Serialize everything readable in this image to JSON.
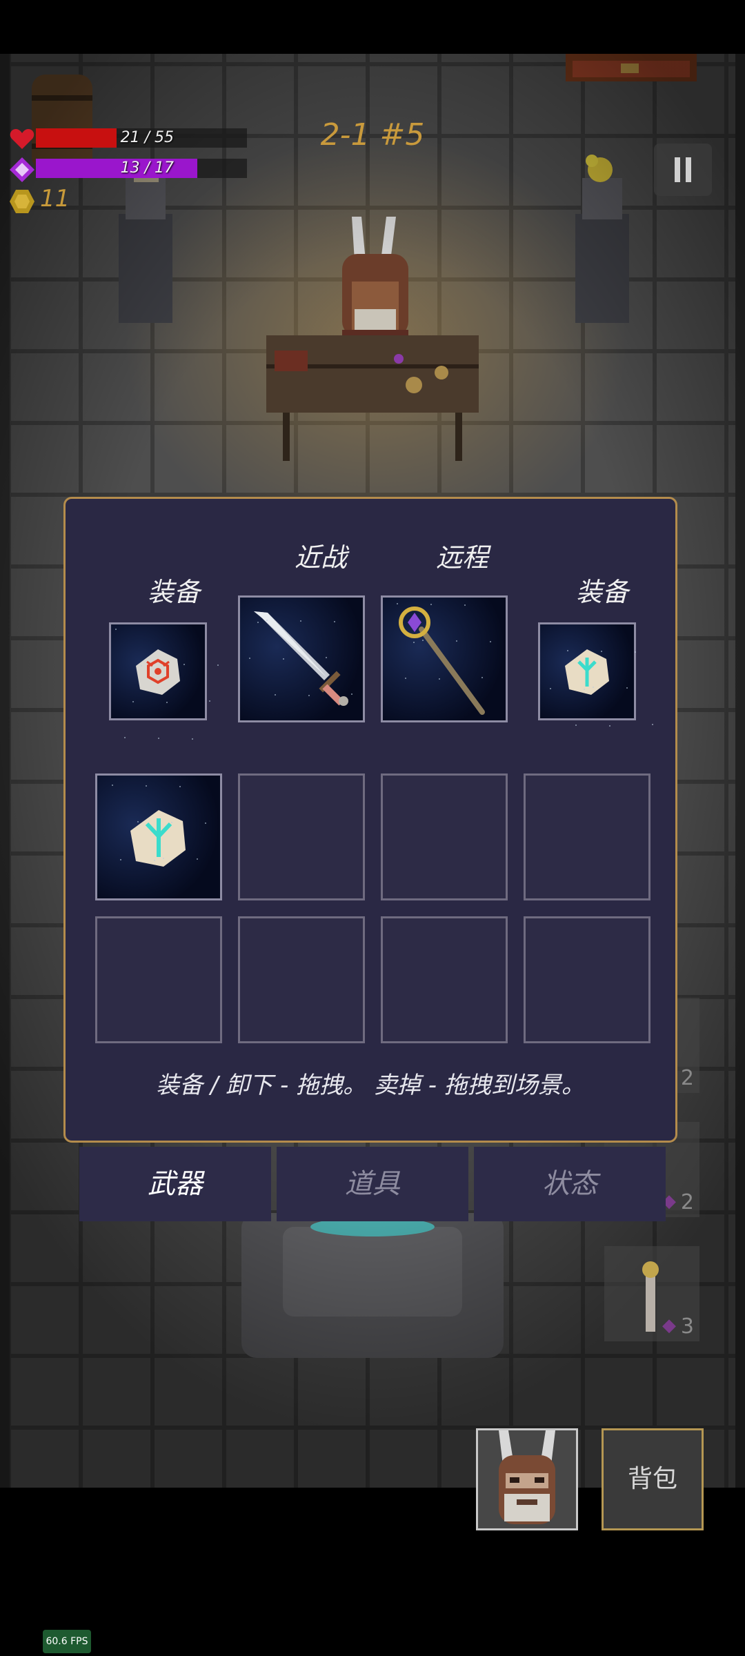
{
  "hud": {
    "health": {
      "current": 21,
      "max": 55,
      "text": "21 / 55",
      "color": "#c81010"
    },
    "mana": {
      "current": 13,
      "max": 17,
      "text": "13 / 17",
      "color": "#9a16cc"
    },
    "coins": "11",
    "level": "2-1 #5"
  },
  "side_slots": [
    "2",
    "2",
    "3"
  ],
  "panel": {
    "labels": {
      "equip_left": "装备",
      "melee": "近战",
      "ranged": "远程",
      "equip_right": "装备"
    },
    "equipped": {
      "equip_left_icon": "red-rune-stone-icon",
      "melee_icon": "sword-icon",
      "ranged_icon": "magic-staff-icon",
      "equip_right_icon": "cyan-rune-stone-icon"
    },
    "inventory": [
      "cyan-rune-stone-icon",
      "",
      "",
      "",
      "",
      "",
      "",
      ""
    ],
    "hint": "装备 / 卸下 - 拖拽。   卖掉 - 拖拽到场景。"
  },
  "tabs": [
    {
      "label": "武器",
      "active": true
    },
    {
      "label": "道具",
      "active": false
    },
    {
      "label": "状态",
      "active": false
    }
  ],
  "bag_label": "背包",
  "fps": "60.6 FPS",
  "colors": {
    "panel_bg": "#2a2844",
    "panel_border": "#b48c4c",
    "gold": "#c99a3c"
  }
}
